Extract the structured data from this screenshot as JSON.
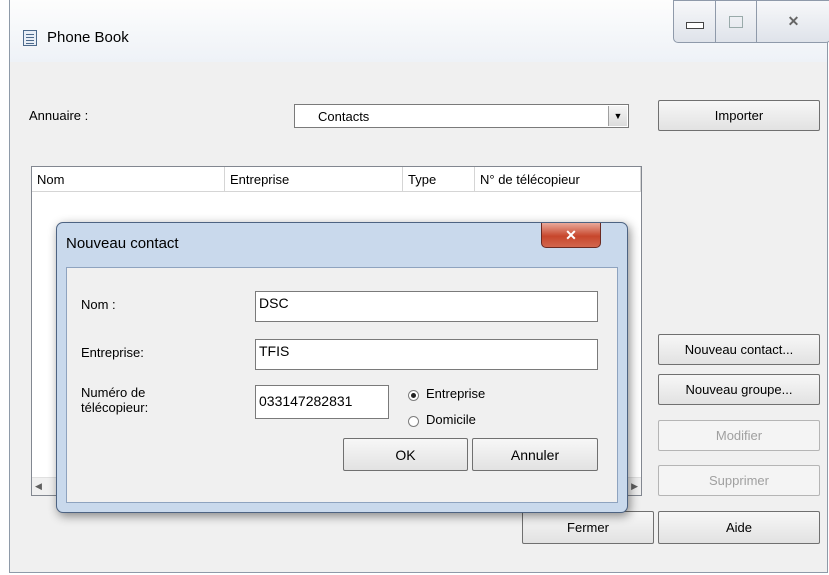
{
  "window": {
    "title": "Phone Book",
    "caption": {
      "minimize": "—",
      "maximize": "□",
      "close": "✕"
    }
  },
  "main": {
    "annuaire_label": "Annuaire :",
    "annuaire_value": "Contacts",
    "combo_arrow": "▼",
    "columns": [
      "Nom",
      "Entreprise",
      "Type",
      "N° de télécopieur"
    ],
    "scroll_left": "◀",
    "scroll_right": "▶",
    "buttons": {
      "importer": "Importer",
      "nouveau_contact": "Nouveau contact...",
      "nouveau_groupe": "Nouveau groupe...",
      "modifier": "Modifier",
      "supprimer": "Supprimer",
      "fermer": "Fermer",
      "aide": "Aide"
    }
  },
  "dialog": {
    "title": "Nouveau contact",
    "close": "✕",
    "nom_label": "Nom :",
    "nom_value": "DSC",
    "entreprise_label": "Entreprise:",
    "entreprise_value": "TFIS",
    "fax_label_line1": "Numéro de",
    "fax_label_line2": "télécopieur:",
    "fax_value": "033147282831",
    "radio_entreprise": "Entreprise",
    "radio_domicile": "Domicile",
    "radio_selected": "Entreprise",
    "ok": "OK",
    "annuler": "Annuler"
  }
}
